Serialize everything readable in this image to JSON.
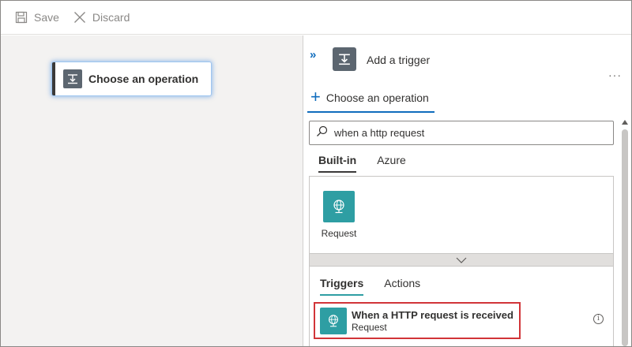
{
  "toolbar": {
    "save_label": "Save",
    "discard_label": "Discard"
  },
  "canvas": {
    "card_title": "Choose an operation"
  },
  "panel": {
    "collapse_glyph": "»",
    "trigger_title": "Add a trigger",
    "more_glyph": "···",
    "op_tab_label": "Choose an operation",
    "search": {
      "value": "when a http request",
      "placeholder": ""
    },
    "top_pivots": {
      "builtin": "Built-in",
      "azure": "Azure"
    },
    "connector": {
      "label": "Request"
    },
    "result_pivots": {
      "triggers": "Triggers",
      "actions": "Actions"
    },
    "result": {
      "title": "When a HTTP request is received",
      "subtitle": "Request"
    },
    "info_glyph": "i"
  },
  "colors": {
    "accent_blue": "#0f6cbd",
    "connector_teal": "#2e9ea3",
    "highlight_red": "#d13438",
    "operation_icon_gray": "#5c6670",
    "canvas_bg": "#f3f2f1"
  },
  "icons": {
    "save": "save-icon",
    "discard": "close-icon",
    "operation": "operation-icon",
    "search": "search-icon",
    "request": "globe-request-icon",
    "expand": "chevron-down-icon",
    "info": "info-icon"
  }
}
